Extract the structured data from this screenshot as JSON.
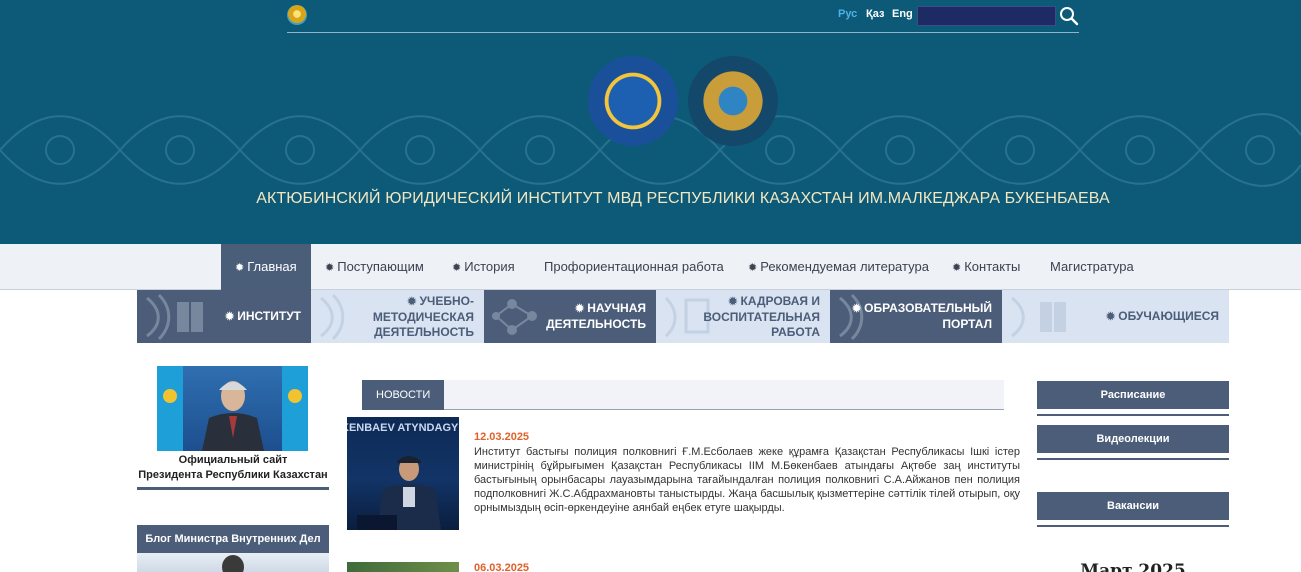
{
  "header": {
    "langs": {
      "ru": "Рус",
      "kz": "Қаз",
      "en": "Eng"
    },
    "search_placeholder": "",
    "title": "АКТЮБИНСКИЙ ЮРИДИЧЕСКИЙ ИНСТИТУТ МВД РЕСПУБЛИКИ КАЗАХСТАН ИМ.МАЛКЕДЖАРА БУКЕНБАЕВА"
  },
  "nav": {
    "items": [
      "Главная",
      "Поступающим",
      "История",
      "Профориентационная работа",
      "Рекомендуемая литература",
      "Контакты",
      "Магистратура"
    ]
  },
  "sections": {
    "items": [
      {
        "line1": "ИНСТИТУТ",
        "line2": ""
      },
      {
        "line1": "УЧЕБНО-МЕТОДИЧЕСКАЯ",
        "line2": "ДЕЯТЕЛЬНОСТЬ"
      },
      {
        "line1": "НАУЧНАЯ",
        "line2": "ДЕЯТЕЛЬНОСТЬ"
      },
      {
        "line1": "КАДРОВАЯ И",
        "line2": "ВОСПИТАТЕЛЬНАЯ РАБОТА"
      },
      {
        "line1": "ОБРАЗОВАТЕЛЬНЫЙ",
        "line2": "ПОРТАЛ"
      },
      {
        "line1": "ОБУЧАЮЩИЕСЯ",
        "line2": ""
      }
    ]
  },
  "left": {
    "president_photo_banner": "",
    "president_caption_1": "Официальный сайт",
    "president_caption_2": "Президента Республики Казахстан",
    "blog_title": "Блог Министра Внутренних Дел"
  },
  "news": {
    "tab": "НОВОСТИ",
    "items": [
      {
        "date": "12.03.2025",
        "image_text": "KENBAEV ATYNDAGY",
        "text": "Институт бастығы полиция полковнигі Ғ.М.Есболаев жеке құрамға Қазақстан Республикасы Ішкі істер министрінің бұйрығымен Қазақстан Республикасы ІІМ М.Бөкенбаев атындағы Ақтөбе заң институты бастығының орынбасары лауазымдарына тағайындалған полиция полковнигі С.А.Айжанов пен полиция подполковнигі Ж.С.Абдрахмановты таныстырды. Жаңа басшылық қызметтеріне сәттілік тілей отырып, оқу орнымыздың өсіп-өркендеуіне аянбай еңбек етуге шақырды."
      },
      {
        "date": "06.03.2025"
      }
    ]
  },
  "right": {
    "btn_schedule": "Расписание",
    "btn_video": "Видеолекции",
    "btn_vacancies": "Вакансии",
    "calendar_title": "Март 2025"
  },
  "colors": {
    "header_bg": "#0c5a78",
    "accent_dark": "#4b5d78",
    "accent_light": "#d9e3f1",
    "date": "#e0612b",
    "title": "#f3e7c0"
  }
}
